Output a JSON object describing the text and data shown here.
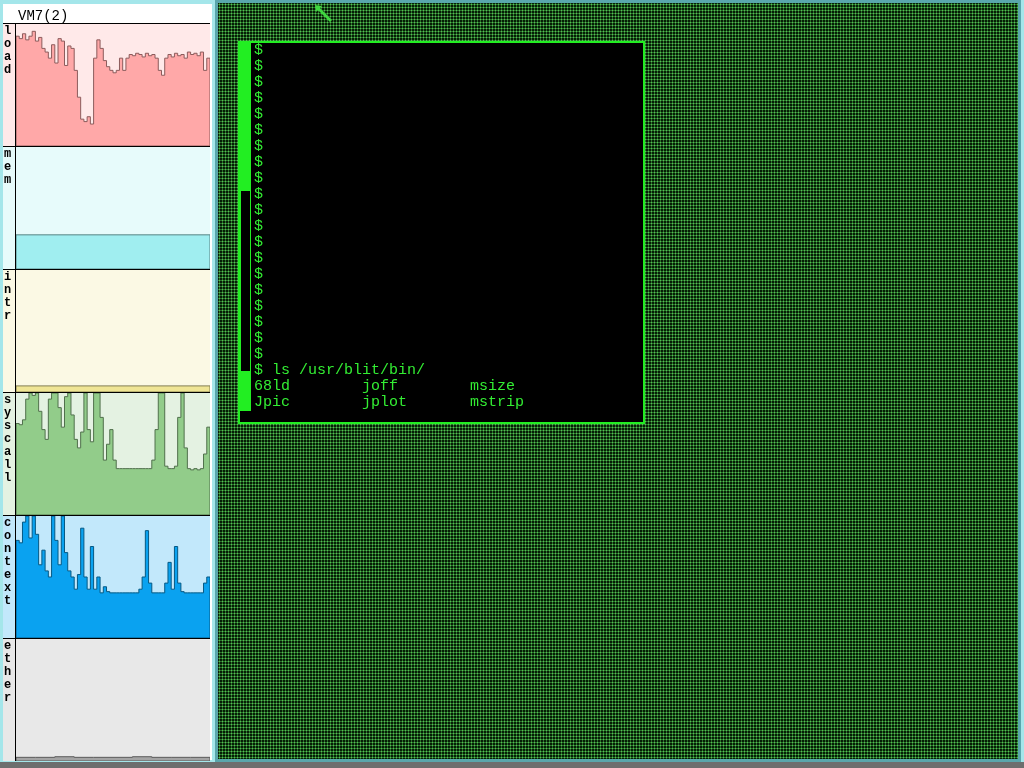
{
  "monitor": {
    "title": "VM7(2)",
    "graphs": [
      {
        "label": "load",
        "color": "#ffa8a8"
      },
      {
        "label": "mem",
        "color": "#a0eef0"
      },
      {
        "label": "intr",
        "color": "#efe594"
      },
      {
        "label": "syscall",
        "color": "#92cc8a"
      },
      {
        "label": "context",
        "color": "#0aa2f0"
      },
      {
        "label": "ether",
        "color": "#a4a4a4"
      }
    ]
  },
  "terminal": {
    "lines": [
      "$",
      "$",
      "$",
      "$",
      "$",
      "$",
      "$",
      "$",
      "$",
      "$",
      "$",
      "$",
      "$",
      "$",
      "$",
      "$",
      "$",
      "$",
      "$",
      "$",
      "$ ls /usr/blit/bin/"
    ],
    "listing": [
      [
        "68ld",
        "joff",
        "msize"
      ],
      [
        "Jpic",
        "jplot",
        "mstrip"
      ]
    ]
  }
}
